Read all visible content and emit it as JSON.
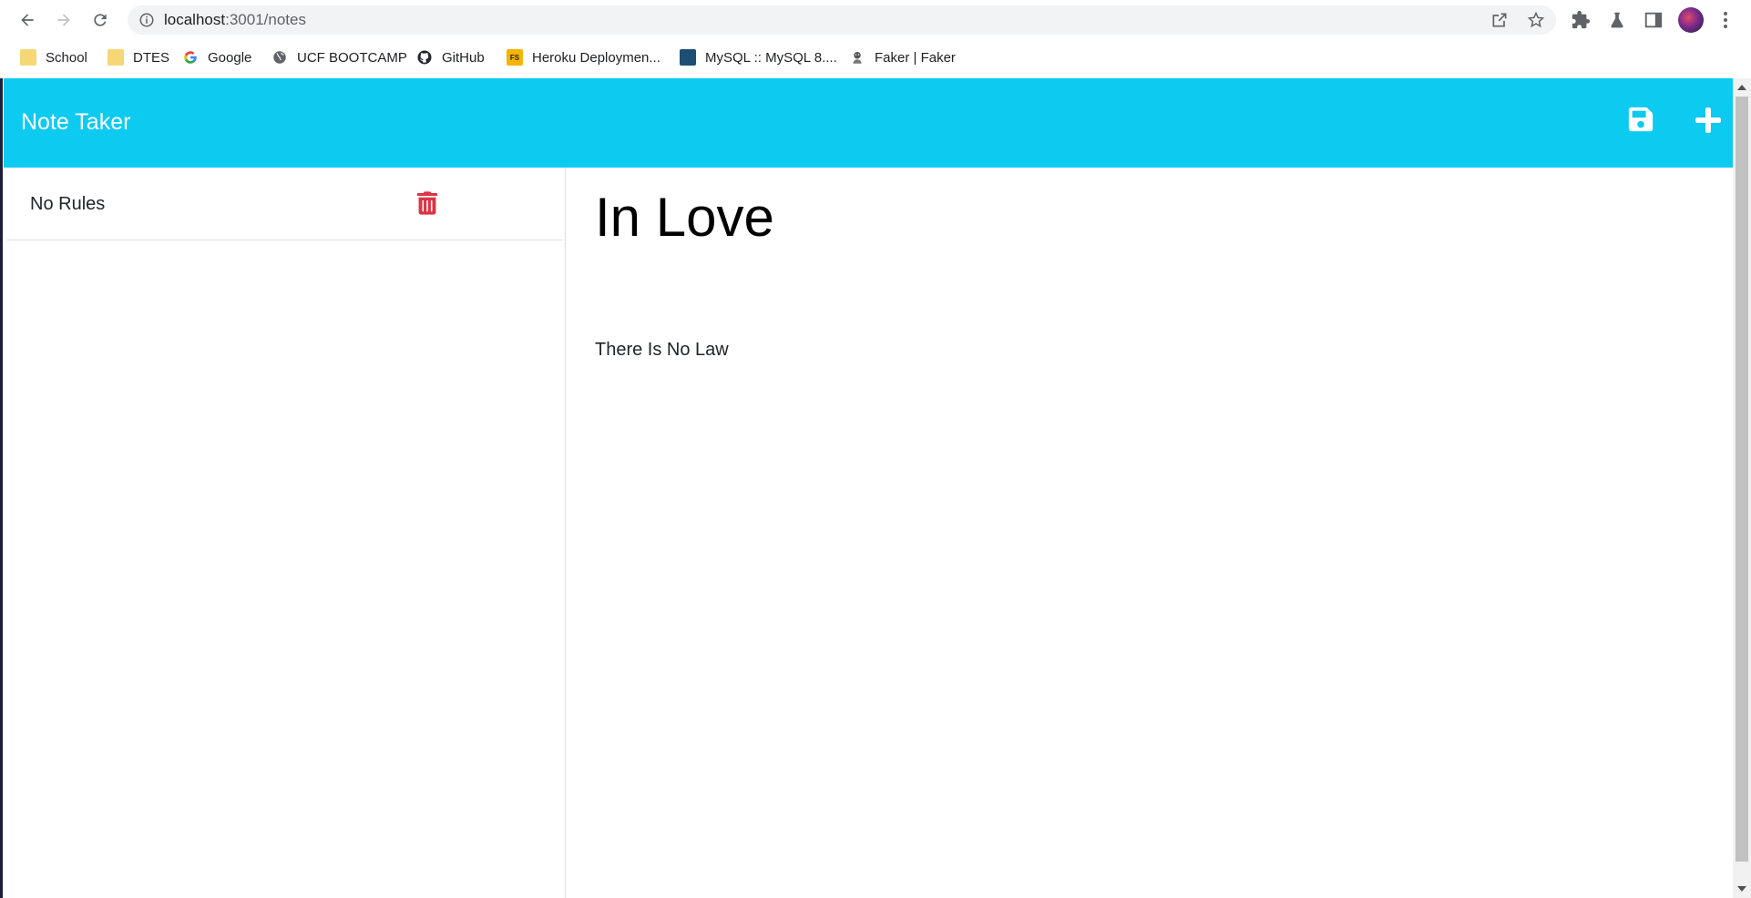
{
  "browser": {
    "url_host": "localhost",
    "url_path": ":3001/notes",
    "bookmarks": [
      {
        "label": "School",
        "icon": "folder-icon"
      },
      {
        "label": "DTES",
        "icon": "folder-icon"
      },
      {
        "label": "Google",
        "icon": "google-icon"
      },
      {
        "label": "UCF BOOTCAMP",
        "icon": "globe-icon"
      },
      {
        "label": "GitHub",
        "icon": "github-icon"
      },
      {
        "label": "Heroku Deploymen...",
        "icon": "heroku-icon"
      },
      {
        "label": "MySQL :: MySQL 8....",
        "icon": "mysql-icon"
      },
      {
        "label": "Faker | Faker",
        "icon": "faker-icon"
      }
    ]
  },
  "navbar": {
    "brand": "Note Taker",
    "bg_color": "#0dcaf0"
  },
  "notes": [
    {
      "title": "No Rules"
    }
  ],
  "active_note": {
    "title": "In Love",
    "text": "There Is No Law"
  },
  "colors": {
    "trash": "#dc3545",
    "navbar": "#0dcaf0"
  }
}
